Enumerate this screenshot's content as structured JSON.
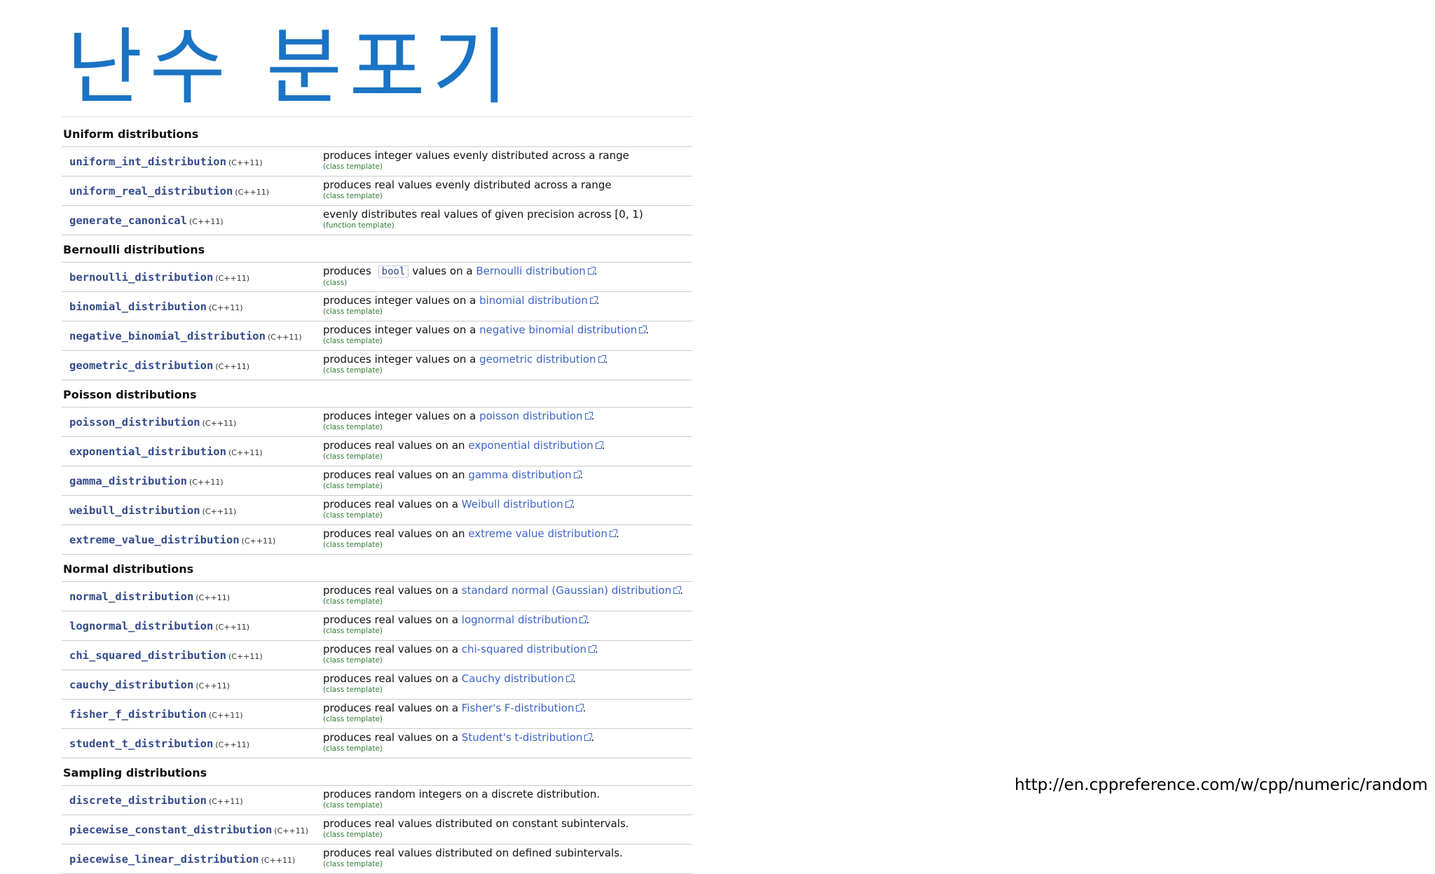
{
  "title": "난수 분포기",
  "std_tag": "(C++11)",
  "sections": [
    {
      "heading": "Uniform distributions",
      "items": [
        {
          "name": "uniform_int_distribution",
          "desc": "produces integer values evenly distributed across a range",
          "kind": "(class template)"
        },
        {
          "name": "uniform_real_distribution",
          "desc": "produces real values evenly distributed across a range",
          "kind": "(class template)"
        },
        {
          "name": "generate_canonical",
          "desc": "evenly distributes real values of given precision across [0, 1)",
          "kind": "(function template)"
        }
      ]
    },
    {
      "heading": "Bernoulli distributions",
      "items": [
        {
          "name": "bernoulli_distribution",
          "prefix": "produces",
          "code": "bool",
          "mid": "values on a",
          "link": "Bernoulli distribution",
          "suffix": ".",
          "kind": "(class)"
        },
        {
          "name": "binomial_distribution",
          "prefix": "produces integer values on a",
          "link": "binomial distribution",
          "suffix": ".",
          "kind": "(class template)"
        },
        {
          "name": "negative_binomial_distribution",
          "prefix": "produces integer values on a",
          "link": "negative binomial distribution",
          "suffix": ".",
          "kind": "(class template)"
        },
        {
          "name": "geometric_distribution",
          "prefix": "produces integer values on a",
          "link": "geometric distribution",
          "suffix": ".",
          "kind": "(class template)"
        }
      ]
    },
    {
      "heading": "Poisson distributions",
      "items": [
        {
          "name": "poisson_distribution",
          "prefix": "produces integer values on a",
          "link": "poisson distribution",
          "suffix": ".",
          "kind": "(class template)"
        },
        {
          "name": "exponential_distribution",
          "prefix": "produces real values on an",
          "link": "exponential distribution",
          "suffix": ".",
          "kind": "(class template)"
        },
        {
          "name": "gamma_distribution",
          "prefix": "produces real values on an",
          "link": "gamma distribution",
          "suffix": ".",
          "kind": "(class template)"
        },
        {
          "name": "weibull_distribution",
          "prefix": "produces real values on a",
          "link": "Weibull distribution",
          "suffix": ".",
          "kind": "(class template)"
        },
        {
          "name": "extreme_value_distribution",
          "prefix": "produces real values on an",
          "link": "extreme value distribution",
          "suffix": ".",
          "kind": "(class template)"
        }
      ]
    },
    {
      "heading": "Normal distributions",
      "items": [
        {
          "name": "normal_distribution",
          "prefix": "produces real values on a",
          "link": "standard normal (Gaussian) distribution",
          "suffix": ".",
          "kind": "(class template)"
        },
        {
          "name": "lognormal_distribution",
          "prefix": "produces real values on a",
          "link": "lognormal distribution",
          "suffix": ".",
          "kind": "(class template)"
        },
        {
          "name": "chi_squared_distribution",
          "prefix": "produces real values on a",
          "link": "chi-squared distribution",
          "suffix": ".",
          "kind": "(class template)"
        },
        {
          "name": "cauchy_distribution",
          "prefix": "produces real values on a",
          "link": "Cauchy distribution",
          "suffix": ".",
          "kind": "(class template)"
        },
        {
          "name": "fisher_f_distribution",
          "prefix": "produces real values on a",
          "link": "Fisher's F-distribution",
          "suffix": ".",
          "kind": "(class template)"
        },
        {
          "name": "student_t_distribution",
          "prefix": "produces real values on a",
          "link": "Student's t-distribution",
          "suffix": ".",
          "kind": "(class template)"
        }
      ]
    },
    {
      "heading": "Sampling distributions",
      "items": [
        {
          "name": "discrete_distribution",
          "desc": "produces random integers on a discrete distribution.",
          "kind": "(class template)"
        },
        {
          "name": "piecewise_constant_distribution",
          "desc": "produces real values distributed on constant subintervals.",
          "kind": "(class template)"
        },
        {
          "name": "piecewise_linear_distribution",
          "desc": "produces real values distributed on defined subintervals.",
          "kind": "(class template)"
        }
      ]
    }
  ],
  "source_url": "http://en.cppreference.com/w/cpp/numeric/random"
}
